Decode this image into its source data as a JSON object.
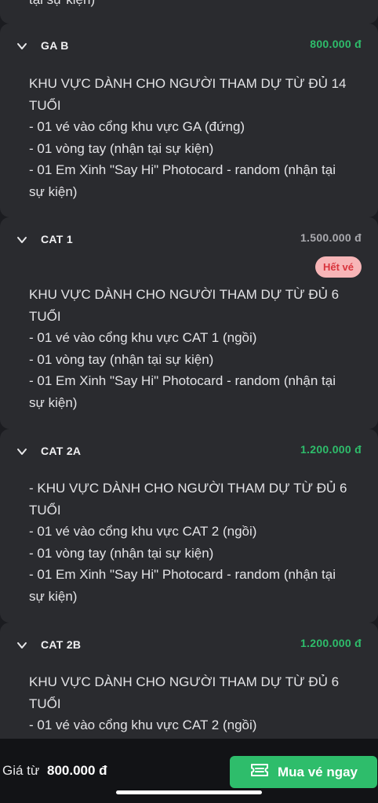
{
  "top_fragment": {
    "text": "tại sự kiện)"
  },
  "tickets": [
    {
      "name": "GA B",
      "price": "800.000 đ",
      "status": "available",
      "badge": "",
      "description": "KHU VỰC DÀNH CHO NGƯỜI THAM DỰ TỪ ĐỦ 14 TUỔI\n- 01 vé vào cổng khu vực GA (đứng)\n- 01 vòng tay (nhận tại sự kiện)\n- 01 Em Xinh \"Say Hi\" Photocard - random (nhận tại sự kiện)"
    },
    {
      "name": "CAT 1",
      "price": "1.500.000 đ",
      "status": "soldout",
      "badge": "Hết vé",
      "description": "KHU VỰC DÀNH CHO NGƯỜI THAM DỰ TỪ ĐỦ 6 TUỔI\n- 01 vé vào cổng khu vực CAT 1 (ngồi)\n- 01 vòng tay (nhận tại sự kiện)\n- 01 Em Xinh \"Say Hi\" Photocard - random (nhận tại sự kiện)"
    },
    {
      "name": "CAT 2A",
      "price": "1.200.000 đ",
      "status": "available",
      "badge": "",
      "description": "- KHU VỰC DÀNH CHO NGƯỜI THAM DỰ TỪ ĐỦ 6 TUỔI\n- 01 vé vào cổng khu vực CAT 2 (ngồi)\n- 01 vòng tay (nhận tại sự kiện)\n- 01 Em Xinh \"Say Hi\" Photocard - random (nhận tại sự kiện)"
    },
    {
      "name": "CAT 2B",
      "price": "1.200.000 đ",
      "status": "available",
      "badge": "",
      "description": "KHU VỰC DÀNH CHO NGƯỜI THAM DỰ TỪ ĐỦ 6 TUỔI\n- 01 vé vào cổng khu vực CAT 2 (ngồi)"
    }
  ],
  "footer": {
    "from_label": "Giá từ",
    "from_price": "800.000 đ",
    "buy_label": "Mua vé ngay",
    "buy_icon": "ticket-icon"
  },
  "colors": {
    "background": "#1b1c20",
    "card": "#2a2b2f",
    "accent_green": "#2ebd6b",
    "soldout_badge_bg": "#f7b5b7",
    "soldout_badge_text": "#d8343c"
  }
}
